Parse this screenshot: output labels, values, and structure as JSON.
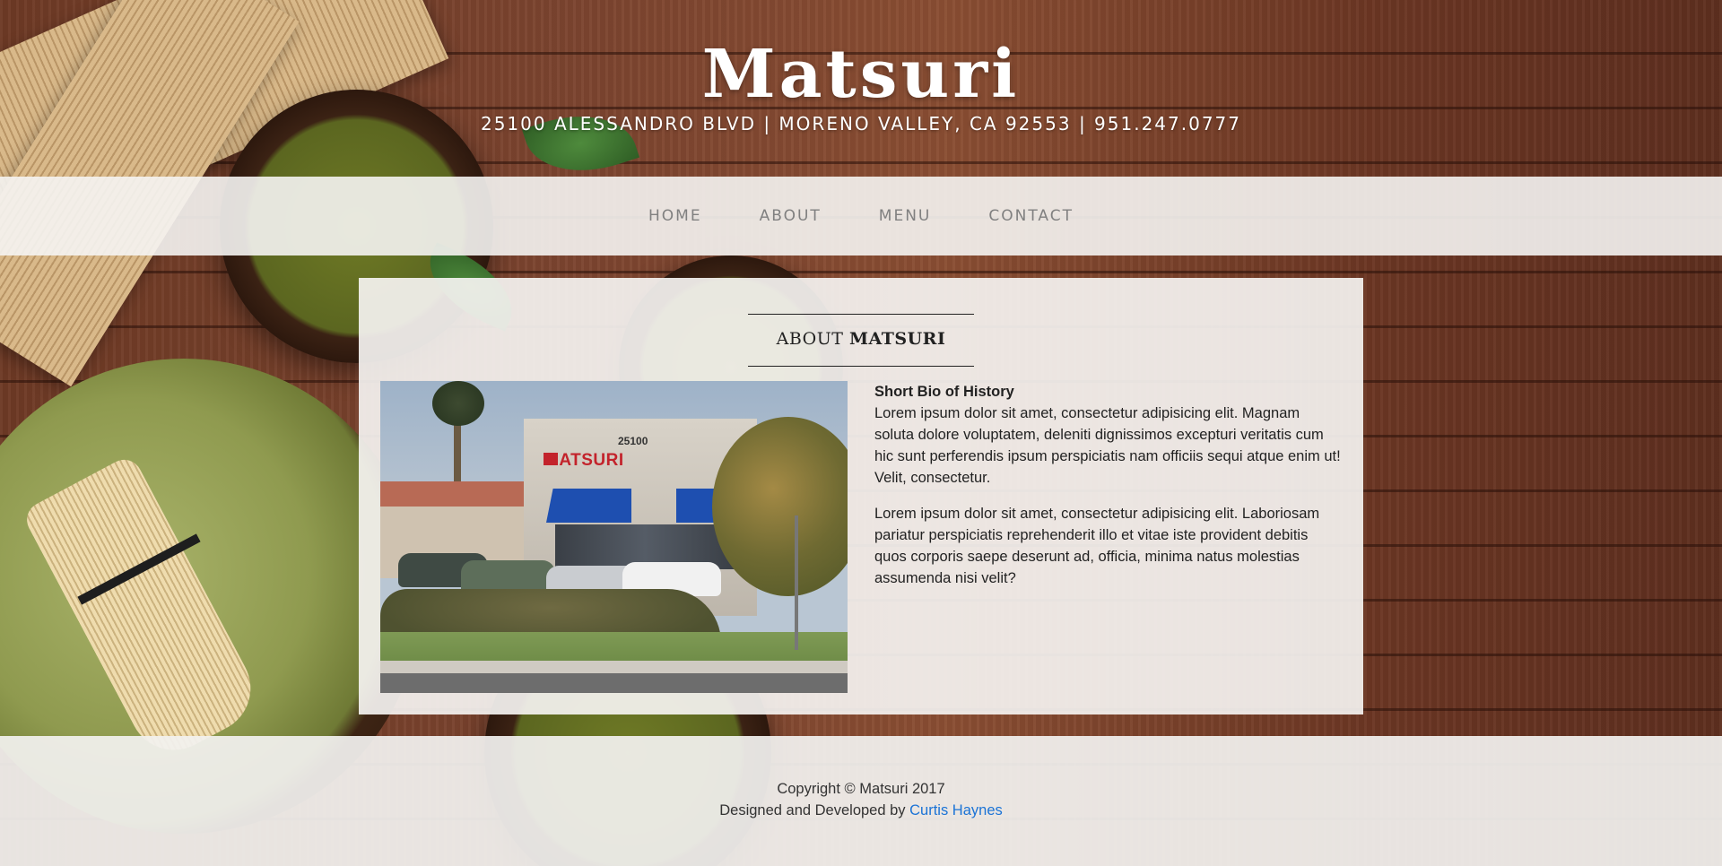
{
  "site": {
    "title": "Matsuri",
    "address": "25100 ALESSANDRO BLVD | MORENO VALLEY, CA 92553 | 951.247.0777"
  },
  "nav": {
    "items": [
      {
        "label": "HOME"
      },
      {
        "label": "ABOUT"
      },
      {
        "label": "MENU"
      },
      {
        "label": "CONTACT"
      }
    ]
  },
  "about": {
    "heading_light": "ABOUT",
    "heading_strong": "MATSURI",
    "photo": {
      "sign_text": "MATSURI",
      "building_number": "25100"
    },
    "bio_title": "Short Bio of History",
    "paragraph1": "Lorem ipsum dolor sit amet, consectetur adipisicing elit. Magnam soluta dolore voluptatem, deleniti dignissimos excepturi veritatis cum hic sunt perferendis ipsum perspiciatis nam officiis sequi atque enim ut! Velit, consectetur.",
    "paragraph2": "Lorem ipsum dolor sit amet, consectetur adipisicing elit. Laboriosam pariatur perspiciatis reprehenderit illo et vitae iste provident debitis quos corporis saepe deserunt ad, officia, minima natus molestias assumenda nisi velit?"
  },
  "footer": {
    "copyright": "Copyright © Matsuri 2017",
    "credit_prefix": "Designed and Developed by ",
    "credit_link": "Curtis Haynes"
  },
  "colors": {
    "link": "#1a73d6",
    "nav_text": "#808080",
    "wood": "#7d4530"
  }
}
